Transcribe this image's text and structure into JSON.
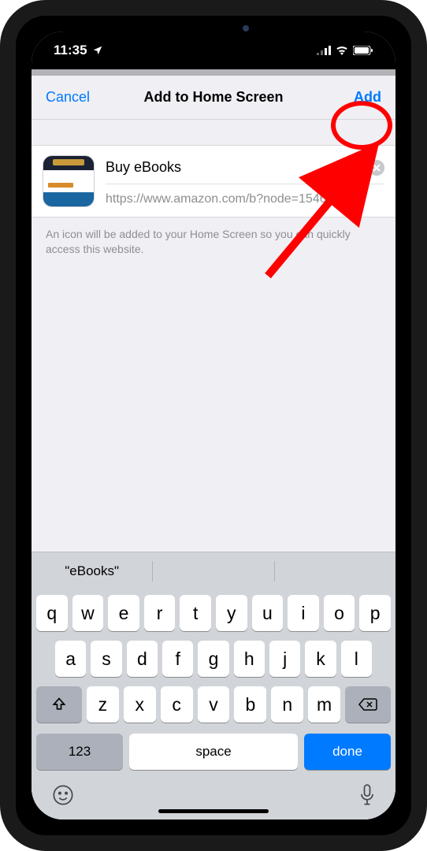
{
  "status": {
    "time": "11:35"
  },
  "nav": {
    "cancel": "Cancel",
    "title": "Add to Home Screen",
    "add": "Add"
  },
  "form": {
    "name": "Buy eBooks",
    "url": "https://www.amazon.com/b?node=1546...",
    "hint": "An icon will be added to your Home Screen so you can quickly access this website."
  },
  "suggest": {
    "s1": "\"eBooks\"",
    "s2": "",
    "s3": ""
  },
  "keys": {
    "r1": [
      "q",
      "w",
      "e",
      "r",
      "t",
      "y",
      "u",
      "i",
      "o",
      "p"
    ],
    "r2": [
      "a",
      "s",
      "d",
      "f",
      "g",
      "h",
      "j",
      "k",
      "l"
    ],
    "r3": [
      "z",
      "x",
      "c",
      "v",
      "b",
      "n",
      "m"
    ],
    "k123": "123",
    "space": "space",
    "done": "done"
  }
}
